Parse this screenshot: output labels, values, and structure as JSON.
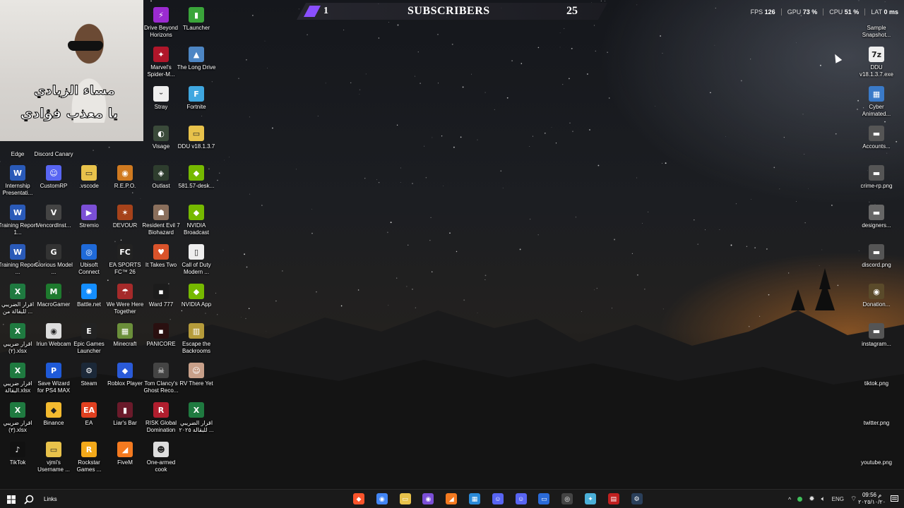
{
  "overlay": {
    "subscribers_left": "1",
    "subscribers_title": "SUBSCRIBERS",
    "subscribers_right": "25",
    "stats": [
      {
        "label": "FPS",
        "value": "126"
      },
      {
        "label": "GPU",
        "value": "73 %"
      },
      {
        "label": "CPU",
        "value": "51 %"
      },
      {
        "label": "LAT",
        "value": "0 ms"
      }
    ],
    "webcam_caption_line1": "مساء الزبادي",
    "webcam_caption_line2": "يا معذب فؤادي"
  },
  "desktop_icons": [
    {
      "id": "drive-beyond",
      "label": "Drive Beyond Horizons",
      "glyph": "⚡",
      "color": "#9b2bd0",
      "col": 0,
      "row": 0
    },
    {
      "id": "tlauncher",
      "label": "TLauncher",
      "glyph": "▮",
      "color": "#3aa53a",
      "col": 1,
      "row": 0
    },
    {
      "id": "spiderman",
      "label": "Marvel's Spider-M...",
      "glyph": "✦",
      "color": "#b0162a",
      "col": 0,
      "row": 1
    },
    {
      "id": "long-drive",
      "label": "The Long Drive",
      "glyph": "▲",
      "color": "#4d86c4",
      "col": 1,
      "row": 1
    },
    {
      "id": "stray",
      "label": "Stray",
      "glyph": "ᵕ",
      "color": "#eeeeee",
      "col": 0,
      "row": 2
    },
    {
      "id": "fortnite",
      "label": "Fortnite",
      "glyph": "F",
      "color": "#3fa7e0",
      "col": 1,
      "row": 2
    },
    {
      "id": "visage",
      "label": "Visage",
      "glyph": "◐",
      "color": "#3a4a3a",
      "col": 0,
      "row": 3
    },
    {
      "id": "ddu-folder",
      "label": "DDU v18.1.3.7",
      "glyph": "▭",
      "color": "#e8c24b",
      "col": 1,
      "row": 3
    },
    {
      "id": "edge",
      "label": "Edge",
      "glyph": "",
      "color": "transparent",
      "colx": -4,
      "row": 3.2
    },
    {
      "id": "discord-canary",
      "label": "Discord Canary",
      "glyph": "",
      "color": "transparent",
      "colx": -3,
      "row": 3.2
    },
    {
      "id": "internship",
      "label": "Internship Presentati...",
      "glyph": "W",
      "color": "#2a5ab8",
      "colx": -4,
      "row": 4
    },
    {
      "id": "customrp",
      "label": "CustomRP",
      "glyph": "☺",
      "color": "#5865f2",
      "colx": -3,
      "row": 4
    },
    {
      "id": "vscode-folder",
      "label": ".vscode",
      "glyph": "▭",
      "color": "#e8c24b",
      "colx": -2,
      "row": 4
    },
    {
      "id": "repo",
      "label": "R.E.P.O.",
      "glyph": "◉",
      "color": "#d07a20",
      "colx": -1,
      "row": 4
    },
    {
      "id": "outlast",
      "label": "Outlast",
      "glyph": "◈",
      "color": "#2e3d2e",
      "col": 0,
      "row": 4
    },
    {
      "id": "nvidia-desk",
      "label": "581.57-desk...",
      "glyph": "◆",
      "color": "#76b900",
      "col": 1,
      "row": 4
    },
    {
      "id": "training1",
      "label": "Training Report 1...",
      "glyph": "W",
      "color": "#2a5ab8",
      "colx": -4,
      "row": 5
    },
    {
      "id": "vencord",
      "label": "VencordInst...",
      "glyph": "V",
      "color": "#444",
      "colx": -3,
      "row": 5
    },
    {
      "id": "stremio",
      "label": "Stremio",
      "glyph": "▶",
      "color": "#7b4fd6",
      "colx": -2,
      "row": 5
    },
    {
      "id": "devour",
      "label": "DEVOUR",
      "glyph": "✶",
      "color": "#a6421a",
      "colx": -1,
      "row": 5
    },
    {
      "id": "re7",
      "label": "Resident Evil 7 Biohazard",
      "glyph": "☗",
      "color": "#8a6f5c",
      "col": 0,
      "row": 5
    },
    {
      "id": "nvidia-broadcast",
      "label": "NVIDIA Broadcast",
      "glyph": "◆",
      "color": "#76b900",
      "col": 1,
      "row": 5
    },
    {
      "id": "training2",
      "label": "Training Report ...",
      "glyph": "W",
      "color": "#2a5ab8",
      "colx": -4,
      "row": 6
    },
    {
      "id": "glorious",
      "label": "Glorious Model ...",
      "glyph": "G",
      "color": "#333",
      "colx": -3,
      "row": 6
    },
    {
      "id": "ubisoft",
      "label": "Ubisoft Connect",
      "glyph": "◎",
      "color": "#1f6ad8",
      "colx": -2,
      "row": 6
    },
    {
      "id": "easports",
      "label": "EA SPORTS FC™ 26",
      "glyph": "FC",
      "color": "#222",
      "colx": -1,
      "row": 6
    },
    {
      "id": "ittakestwo",
      "label": "It Takes Two",
      "glyph": "♥",
      "color": "#d9532b",
      "col": 0,
      "row": 6
    },
    {
      "id": "cod",
      "label": "Call of Duty Modern ...",
      "glyph": "▯",
      "color": "#eeeeee",
      "col": 1,
      "row": 6
    },
    {
      "id": "xlsx1",
      "label": "اقرار الضريبي للبقالة من ...",
      "glyph": "X",
      "color": "#1f7a40",
      "colx": -4,
      "row": 7
    },
    {
      "id": "macrogamer",
      "label": "MacroGamer",
      "glyph": "M",
      "color": "#1e7a2e",
      "colx": -3,
      "row": 7
    },
    {
      "id": "battlenet",
      "label": "Battle.net",
      "glyph": "✺",
      "color": "#148eff",
      "colx": -2,
      "row": 7
    },
    {
      "id": "wewerehere",
      "label": "We Were Here Together",
      "glyph": "☂",
      "color": "#a52a2a",
      "colx": -1,
      "row": 7
    },
    {
      "id": "ward777",
      "label": "Ward 777",
      "glyph": "▪",
      "color": "#1c1c1c",
      "col": 0,
      "row": 7
    },
    {
      "id": "nvidia-app",
      "label": "NVIDIA App",
      "glyph": "◆",
      "color": "#76b900",
      "col": 1,
      "row": 7
    },
    {
      "id": "xlsx2",
      "label": "اقرار ضريبي (٢).xlsx",
      "glyph": "X",
      "color": "#1f7a40",
      "colx": -4,
      "row": 8
    },
    {
      "id": "iriun",
      "label": "Iriun Webcam",
      "glyph": "◉",
      "color": "#ddd",
      "colx": -3,
      "row": 8
    },
    {
      "id": "epic",
      "label": "Epic Games Launcher",
      "glyph": "E",
      "color": "#222",
      "colx": -2,
      "row": 8
    },
    {
      "id": "minecraft",
      "label": "Minecraft",
      "glyph": "▦",
      "color": "#6b8f3a",
      "colx": -1,
      "row": 8
    },
    {
      "id": "panicore",
      "label": "PANICORE",
      "glyph": "▪",
      "color": "#2a1010",
      "col": 0,
      "row": 8
    },
    {
      "id": "escape-backrooms",
      "label": "Escape the Backrooms",
      "glyph": "▥",
      "color": "#b59b3a",
      "col": 1,
      "row": 8
    },
    {
      "id": "xlsx3",
      "label": "اقرار ضريبي البقالة.xlsx",
      "glyph": "X",
      "color": "#1f7a40",
      "colx": -4,
      "row": 9
    },
    {
      "id": "savewizard",
      "label": "Save Wizard for PS4 MAX",
      "glyph": "P",
      "color": "#1f5ad8",
      "colx": -3,
      "row": 9
    },
    {
      "id": "steam",
      "label": "Steam",
      "glyph": "⚙",
      "color": "#1b2838",
      "colx": -2,
      "row": 9
    },
    {
      "id": "roblox",
      "label": "Roblox Player",
      "glyph": "◆",
      "color": "#2a5ad8",
      "colx": -1,
      "row": 9
    },
    {
      "id": "ghostrecon",
      "label": "Tom Clancy's Ghost Reco...",
      "glyph": "☠",
      "color": "#444",
      "col": 0,
      "row": 9
    },
    {
      "id": "rvthereyet",
      "label": "RV There Yet",
      "glyph": "☺",
      "color": "#c8a08a",
      "col": 1,
      "row": 9
    },
    {
      "id": "xlsx4",
      "label": "اقرار ضريبي (٣).xlsx",
      "glyph": "X",
      "color": "#1f7a40",
      "colx": -4,
      "row": 10
    },
    {
      "id": "binance",
      "label": "Binance",
      "glyph": "◆",
      "color": "#f3ba2f",
      "colx": -3,
      "row": 10
    },
    {
      "id": "ea",
      "label": "EA",
      "glyph": "EA",
      "color": "#e04020",
      "colx": -2,
      "row": 10
    },
    {
      "id": "liarsbar",
      "label": "Liar's Bar",
      "glyph": "▮",
      "color": "#6a1a2a",
      "colx": -1,
      "row": 10
    },
    {
      "id": "risk",
      "label": "RISK Global Domination",
      "glyph": "R",
      "color": "#b01e2e",
      "col": 0,
      "row": 10
    },
    {
      "id": "xlsx5",
      "label": "اقرار الضريبي للبقالة ٢٠٢٥ ...",
      "glyph": "X",
      "color": "#1f7a40",
      "col": 1,
      "row": 10
    },
    {
      "id": "tiktok",
      "label": "TikTok",
      "glyph": "♪",
      "color": "#111",
      "colx": -4,
      "row": 11
    },
    {
      "id": "vjmi",
      "label": "vjmi's Username ...",
      "glyph": "▭",
      "color": "#e8c24b",
      "colx": -3,
      "row": 11
    },
    {
      "id": "rockstar",
      "label": "Rockstar Games ...",
      "glyph": "R",
      "color": "#f3a91a",
      "colx": -2,
      "row": 11
    },
    {
      "id": "fivem",
      "label": "FiveM",
      "glyph": "◢",
      "color": "#f47a20",
      "colx": -1,
      "row": 11
    },
    {
      "id": "onearmedcook",
      "label": "One-armed cook",
      "glyph": "☻",
      "color": "#ddd",
      "col": 0,
      "row": 11
    }
  ],
  "right_icons": [
    {
      "id": "sample-snapshot",
      "label": "Sample Snapshot...",
      "glyph": "",
      "color": "transparent"
    },
    {
      "id": "ddu-exe",
      "label": "DDU v18.1.3.7.exe",
      "glyph": "7z",
      "color": "#eeeeee"
    },
    {
      "id": "cyber-animated",
      "label": "Cyber Animated...",
      "glyph": "▦",
      "color": "#3a7ac8"
    },
    {
      "id": "accounts",
      "label": "Accounts...",
      "glyph": "▬",
      "color": "#555"
    },
    {
      "id": "crime-rp",
      "label": "crime-rp.png",
      "glyph": "▬",
      "color": "#555"
    },
    {
      "id": "designers",
      "label": "designers...",
      "glyph": "▬",
      "color": "#666"
    },
    {
      "id": "discord-png",
      "label": "discord.png",
      "glyph": "▬",
      "color": "#555"
    },
    {
      "id": "donation",
      "label": "Donation...",
      "glyph": "◉",
      "color": "#5a4a2a"
    },
    {
      "id": "instagram",
      "label": "instagram...",
      "glyph": "▬",
      "color": "#555"
    },
    {
      "id": "tiktok-png",
      "label": "tiktok.png",
      "glyph": "",
      "color": "transparent"
    },
    {
      "id": "twitter-png",
      "label": "twitter.png",
      "glyph": "",
      "color": "transparent"
    },
    {
      "id": "youtube-png",
      "label": "youtube.png",
      "glyph": "",
      "color": "transparent"
    }
  ],
  "taskbar": {
    "search_label": "Links",
    "apps": [
      {
        "id": "brave",
        "glyph": "◆",
        "color": "#fb542b"
      },
      {
        "id": "chrome",
        "glyph": "◉",
        "color": "#4285f4"
      },
      {
        "id": "explorer",
        "glyph": "▭",
        "color": "#e8c24b"
      },
      {
        "id": "chrome-profile",
        "glyph": "◉",
        "color": "#7b4fd6"
      },
      {
        "id": "fivem-tb",
        "glyph": "◢",
        "color": "#f47a20"
      },
      {
        "id": "store",
        "glyph": "▦",
        "color": "#2a8ad8"
      },
      {
        "id": "discord-tb",
        "glyph": "☺",
        "color": "#5865f2"
      },
      {
        "id": "discord-canary-tb",
        "glyph": "☺",
        "color": "#5865f2"
      },
      {
        "id": "remote",
        "glyph": "▭",
        "color": "#2a6ad8"
      },
      {
        "id": "obs",
        "glyph": "◎",
        "color": "#444"
      },
      {
        "id": "copilot",
        "glyph": "✦",
        "color": "#4bb0d8"
      },
      {
        "id": "voicemeeter",
        "glyph": "▤",
        "color": "#c02020"
      },
      {
        "id": "steam-tb",
        "glyph": "⚙",
        "color": "#2a3f5a"
      }
    ],
    "tray_language": "ENG",
    "clock_time": "09:56 م",
    "clock_date": "٢٠٢٥/١٠/٢٠"
  }
}
